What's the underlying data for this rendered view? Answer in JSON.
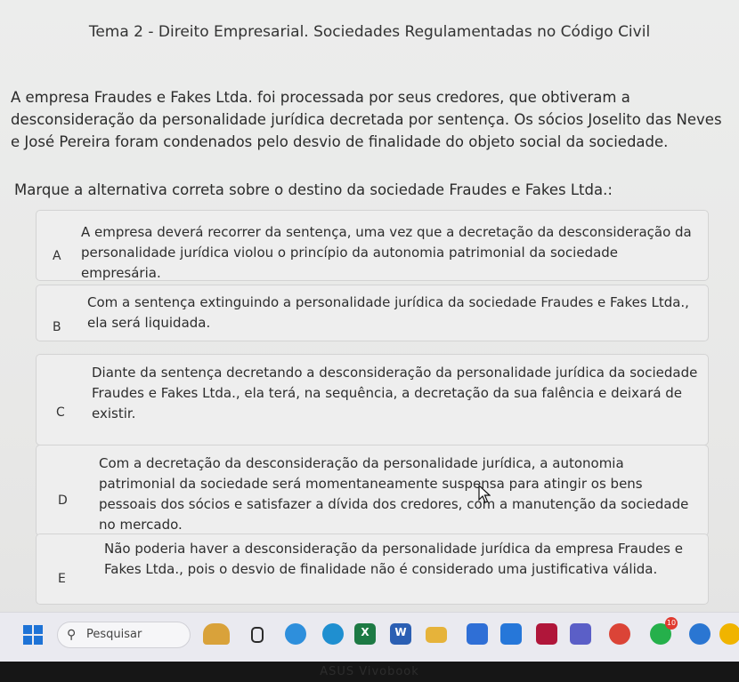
{
  "page": {
    "title": "Tema 2 - Direito Empresarial. Sociedades Regulamentadas no Código Civil"
  },
  "question": {
    "text": "A empresa Fraudes e Fakes Ltda. foi processada por seus credores, que obtiveram a desconsideração da personalidade jurídica decretada por sentença. Os sócios Joselito das Neves e José Pereira foram condenados pelo desvio de finalidade do objeto social da sociedade.",
    "prompt": "Marque a alternativa correta sobre o destino da sociedade Fraudes e Fakes Ltda.:"
  },
  "options": [
    {
      "letter": "A",
      "text": "A empresa deverá recorrer da sentença, uma vez que a decretação da desconsideração da personalidade jurídica violou o princípio da autonomia patrimonial da sociedade empresária."
    },
    {
      "letter": "B",
      "text": "Com a sentença extinguindo a personalidade jurídica da sociedade Fraudes e Fakes Ltda., ela será liquidada."
    },
    {
      "letter": "C",
      "text": "Diante da sentença decretando a desconsideração da personalidade jurídica da sociedade Fraudes e Fakes Ltda., ela terá, na sequência, a decretação da sua falência e deixará de existir."
    },
    {
      "letter": "D",
      "text": "Com a decretação da desconsideração da personalidade jurídica, a autonomia patrimonial da sociedade será momentaneamente suspensa para atingir os bens pessoais dos sócios e satisfazer a dívida dos credores, com a manutenção da sociedade no mercado."
    },
    {
      "letter": "E",
      "text": "Não poderia haver a desconsideração da personalidade jurídica da empresa Fraudes e Fakes Ltda., pois o desvio de finalidade não é considerado uma justificativa válida."
    }
  ],
  "taskbar": {
    "search_placeholder": "Pesquisar",
    "icons": [
      {
        "name": "weather-icon",
        "color": "#d9a23a"
      },
      {
        "name": "task-view-icon",
        "color": "#2b2b2b"
      },
      {
        "name": "copilot-icon",
        "color": "#2e8fdc"
      },
      {
        "name": "edge-icon",
        "color": "#1f8fd0"
      },
      {
        "name": "excel-icon",
        "color": "#1d7a44",
        "label": "X"
      },
      {
        "name": "word-icon",
        "color": "#2b5fb3",
        "label": "W"
      },
      {
        "name": "file-explorer-icon",
        "color": "#e6b33a"
      },
      {
        "name": "store-icon",
        "color": "#2f6fd6"
      },
      {
        "name": "azure-icon",
        "color": "#2677d9"
      },
      {
        "name": "bookmark-icon",
        "color": "#b0163a"
      },
      {
        "name": "teams-icon",
        "color": "#5b5fc7"
      },
      {
        "name": "chrome-icon",
        "color": "#db4437"
      },
      {
        "name": "whatsapp-icon",
        "color": "#25b04b",
        "badge": "10"
      },
      {
        "name": "opera-icon",
        "color": "#2a76d2"
      },
      {
        "name": "chrome-profile-icon",
        "color": "#f0b400"
      }
    ]
  },
  "bezel": {
    "brand": "ASUS Vivobook"
  }
}
